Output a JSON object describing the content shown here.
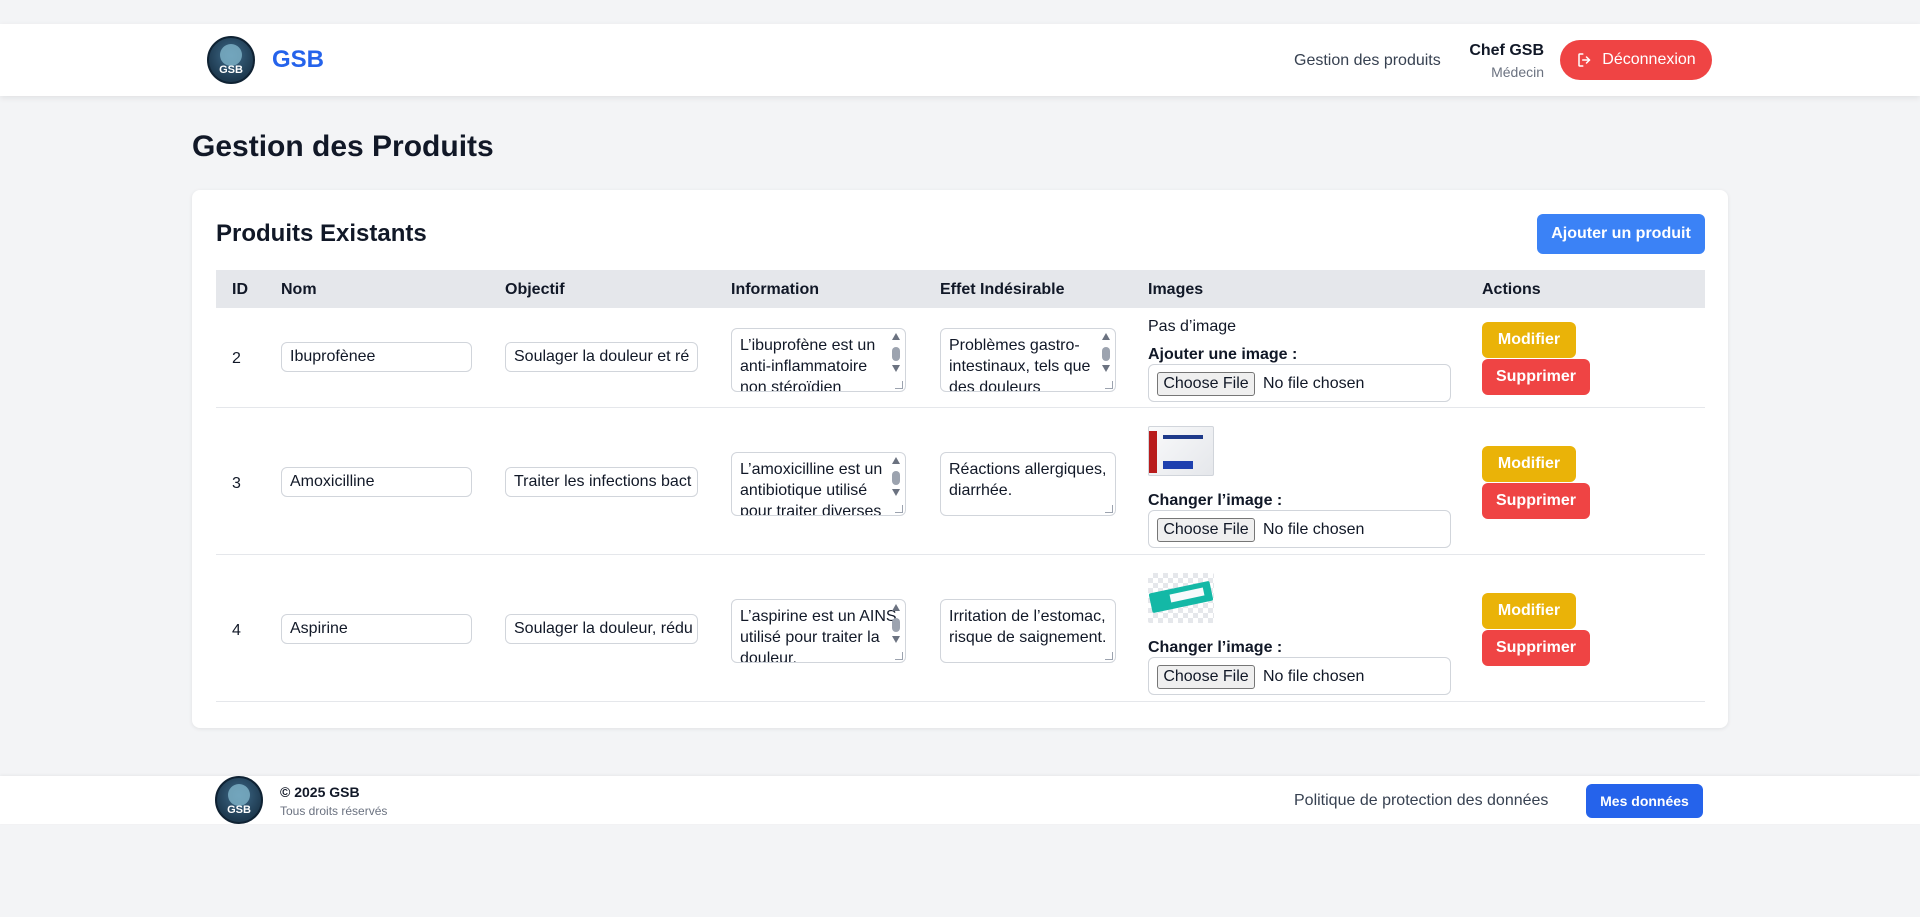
{
  "header": {
    "brand": "GSB",
    "logo_text": "GSB",
    "nav_link": "Gestion des produits",
    "user_name": "Chef GSB",
    "user_role": "Médecin",
    "logout_label": "Déconnexion"
  },
  "page": {
    "title": "Gestion des Produits"
  },
  "card": {
    "title": "Produits Existants",
    "add_button": "Ajouter un produit"
  },
  "table": {
    "columns": [
      "ID",
      "Nom",
      "Objectif",
      "Information",
      "Effet Indésirable",
      "Images",
      "Actions"
    ],
    "rows": [
      {
        "id": "2",
        "nom": "Ibuprofènee",
        "objectif": "Soulager la douleur et ré",
        "information": "L’ibuprofène est un anti-inflammatoire non stéroïdien",
        "effet": "Problèmes gastro-intestinaux, tels que des douleurs",
        "image_status": "Pas d’image",
        "image_label": "Ajouter une image :",
        "choose_file": "Choose File",
        "no_file": "No file chosen",
        "modify": "Modifier",
        "delete": "Supprimer"
      },
      {
        "id": "3",
        "nom": "Amoxicilline",
        "objectif": "Traiter les infections bact",
        "information": "L’amoxicilline est un antibiotique utilisé pour traiter diverses",
        "effet": "Réactions allergiques, diarrhée.",
        "image_label": "Changer l’image :",
        "choose_file": "Choose File",
        "no_file": "No file chosen",
        "modify": "Modifier",
        "delete": "Supprimer"
      },
      {
        "id": "4",
        "nom": "Aspirine",
        "objectif": "Soulager la douleur, rédu",
        "information": "L’aspirine est un AINS utilisé pour traiter la douleur,",
        "effet": "Irritation de l’estomac, risque de saignement.",
        "image_label": "Changer l’image :",
        "choose_file": "Choose File",
        "no_file": "No file chosen",
        "modify": "Modifier",
        "delete": "Supprimer"
      }
    ]
  },
  "footer": {
    "copyright": "© 2025 GSB",
    "rights": "Tous droits réservés",
    "policy_link": "Politique de protection des données",
    "data_button": "Mes données"
  },
  "colors": {
    "primary": "#2563eb",
    "danger": "#ef4444",
    "warning": "#eab308",
    "accent": "#3b82f6"
  }
}
